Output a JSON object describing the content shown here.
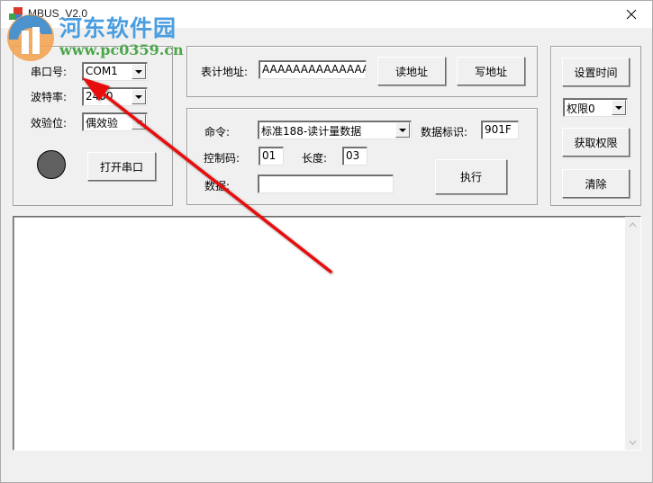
{
  "window": {
    "title": "MBUS_V2.0",
    "close_icon": "close-icon"
  },
  "watermark": {
    "site_name": "河东软件园",
    "url": "www.pc0359.cn"
  },
  "serial_panel": {
    "port_label": "串口号:",
    "port_value": "COM1",
    "baud_label": "波特率:",
    "baud_value": "2400",
    "parity_label": "效验位:",
    "parity_value": "偶效验",
    "status_led": "disconnected",
    "open_button": "打开串口"
  },
  "address_panel": {
    "address_label": "表计地址:",
    "address_value": "AAAAAAAAAAAAAA",
    "read_button": "读地址",
    "write_button": "写地址"
  },
  "command_panel": {
    "command_label": "命令:",
    "command_value": "标准188-读计量数据",
    "data_id_label": "数据标识:",
    "data_id_value": "901F",
    "control_label": "控制码:",
    "control_value": "01",
    "length_label": "长度:",
    "length_value": "03",
    "data_label": "数据:",
    "data_value": "",
    "execute_button": "执行"
  },
  "right_panel": {
    "set_time_button": "设置时间",
    "permission_value": "权限0",
    "get_permission_button": "获取权限",
    "clear_button": "清除"
  },
  "log": {
    "content": ""
  },
  "annotation": {
    "arrow_color": "#e81010"
  }
}
